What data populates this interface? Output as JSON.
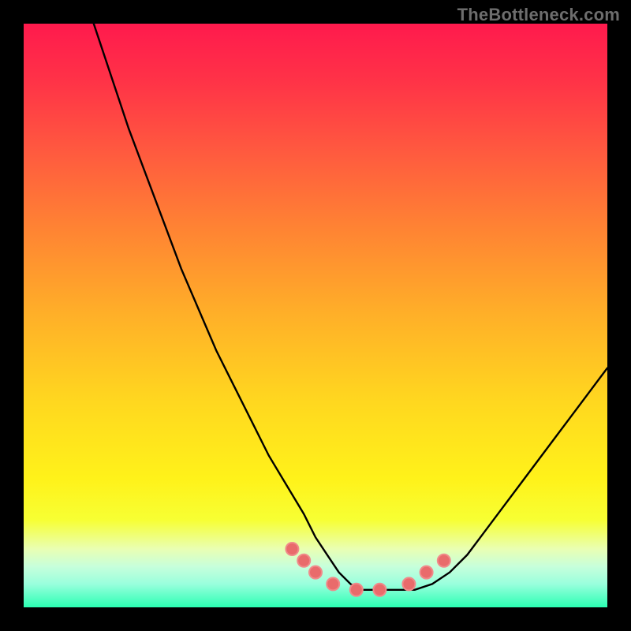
{
  "watermark": "TheBottleneck.com",
  "chart_data": {
    "type": "line",
    "title": "",
    "xlabel": "",
    "ylabel": "",
    "xlim": [
      0,
      100
    ],
    "ylim": [
      0,
      100
    ],
    "grid": false,
    "legend": false,
    "series": [
      {
        "name": "bottleneck-curve",
        "x": [
          12,
          15,
          18,
          21,
          24,
          27,
          30,
          33,
          36,
          39,
          42,
          45,
          48,
          50,
          52,
          54,
          56,
          58,
          61,
          64,
          67,
          70,
          73,
          76,
          79,
          82,
          85,
          88,
          91,
          94,
          97,
          100
        ],
        "values": [
          100,
          91,
          82,
          74,
          66,
          58,
          51,
          44,
          38,
          32,
          26,
          21,
          16,
          12,
          9,
          6,
          4,
          3,
          3,
          3,
          3,
          4,
          6,
          9,
          13,
          17,
          21,
          25,
          29,
          33,
          37,
          41
        ]
      }
    ],
    "markers": {
      "name": "valley-dots",
      "points": [
        {
          "x": 46,
          "y": 10
        },
        {
          "x": 48,
          "y": 8
        },
        {
          "x": 50,
          "y": 6
        },
        {
          "x": 53,
          "y": 4
        },
        {
          "x": 57,
          "y": 3
        },
        {
          "x": 61,
          "y": 3
        },
        {
          "x": 66,
          "y": 4
        },
        {
          "x": 69,
          "y": 6
        },
        {
          "x": 72,
          "y": 8
        }
      ],
      "color": "#e96b6b",
      "radius_px": 8,
      "stroke": "#f08a8a"
    },
    "background_gradient_stops": [
      {
        "pct": 0,
        "color": "#ff1a4d"
      },
      {
        "pct": 50,
        "color": "#ffb028"
      },
      {
        "pct": 85,
        "color": "#f7ff33"
      },
      {
        "pct": 100,
        "color": "#2bffb3"
      }
    ]
  }
}
